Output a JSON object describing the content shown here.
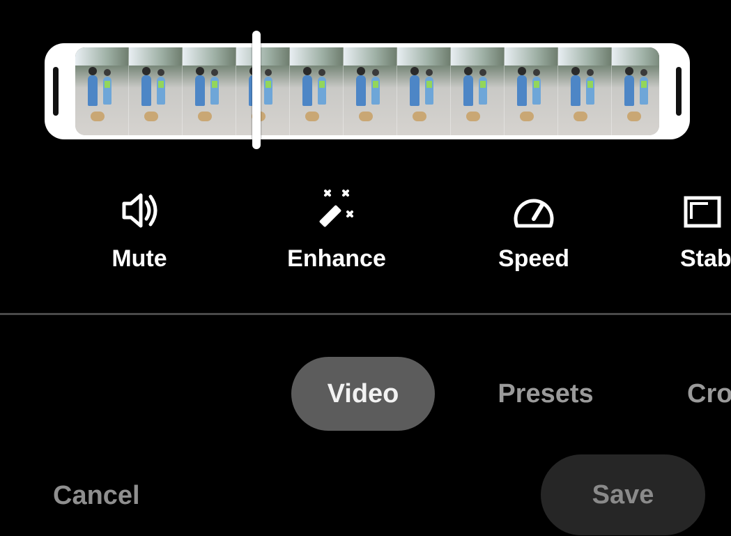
{
  "tools": {
    "mute": {
      "label": "Mute",
      "icon": "speaker-icon"
    },
    "enhance": {
      "label": "Enhance",
      "icon": "magic-wand-icon"
    },
    "speed": {
      "label": "Speed",
      "icon": "speedometer-icon"
    },
    "stabilize": {
      "label": "Stab",
      "icon": "stabilize-icon"
    }
  },
  "tabs": [
    {
      "label": "Video",
      "selected": true
    },
    {
      "label": "Presets",
      "selected": false
    },
    {
      "label": "Cro",
      "selected": false
    }
  ],
  "actions": {
    "cancel_label": "Cancel",
    "save_label": "Save"
  },
  "colors": {
    "background": "#000000",
    "selected_tab": "#5c5c5c",
    "inactive_text": "#9a9a9a",
    "save_button": "#262626"
  },
  "timeline": {
    "frame_count": 11,
    "playhead_fraction": 0.33
  }
}
